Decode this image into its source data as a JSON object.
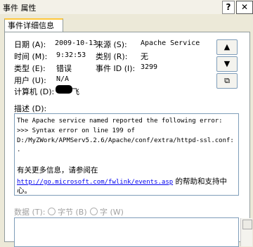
{
  "window": {
    "title": "事件 属性",
    "help_label": "?",
    "close_label": "✕"
  },
  "tabs": [
    {
      "label": "事件详细信息"
    }
  ],
  "fields": {
    "date": {
      "label": "日期 (A):",
      "value": "2009-10-13"
    },
    "time": {
      "label": "时间 (M):",
      "value": "9:32:53"
    },
    "type": {
      "label": "类型 (E):",
      "value": "错误"
    },
    "user": {
      "label": "用户 (U):",
      "value": "N/A"
    },
    "computer": {
      "label": "计算机 (D):",
      "value_suffix": "飞"
    },
    "source": {
      "label": "来源 (S):",
      "value": "Apache Service"
    },
    "category": {
      "label": "类别 (R):",
      "value": "无"
    },
    "event_id": {
      "label": "事件 ID (I):",
      "value": "3299"
    }
  },
  "nav": {
    "up_icon": "▲",
    "down_icon": "▼",
    "copy_icon": "⧉"
  },
  "description": {
    "label": "描述 (D):",
    "lines": [
      "The Apache service named  reported the following error:",
      ">>> Syntax error on line 199 of",
      "D:/MyZWork/APMServ5.2.6/Apache/conf/extra/httpd-ssl.conf:",
      "."
    ],
    "more_info": "有关更多信息，请参阅在",
    "link": "http://go.microsoft.com/fwlink/events.asp",
    "link_suffix": " 的帮助和支持中",
    "tail": "心。"
  },
  "data_section": {
    "label": "数据 (T):",
    "bytes_option": "字节 (B)",
    "words_option": "字 (W)"
  }
}
